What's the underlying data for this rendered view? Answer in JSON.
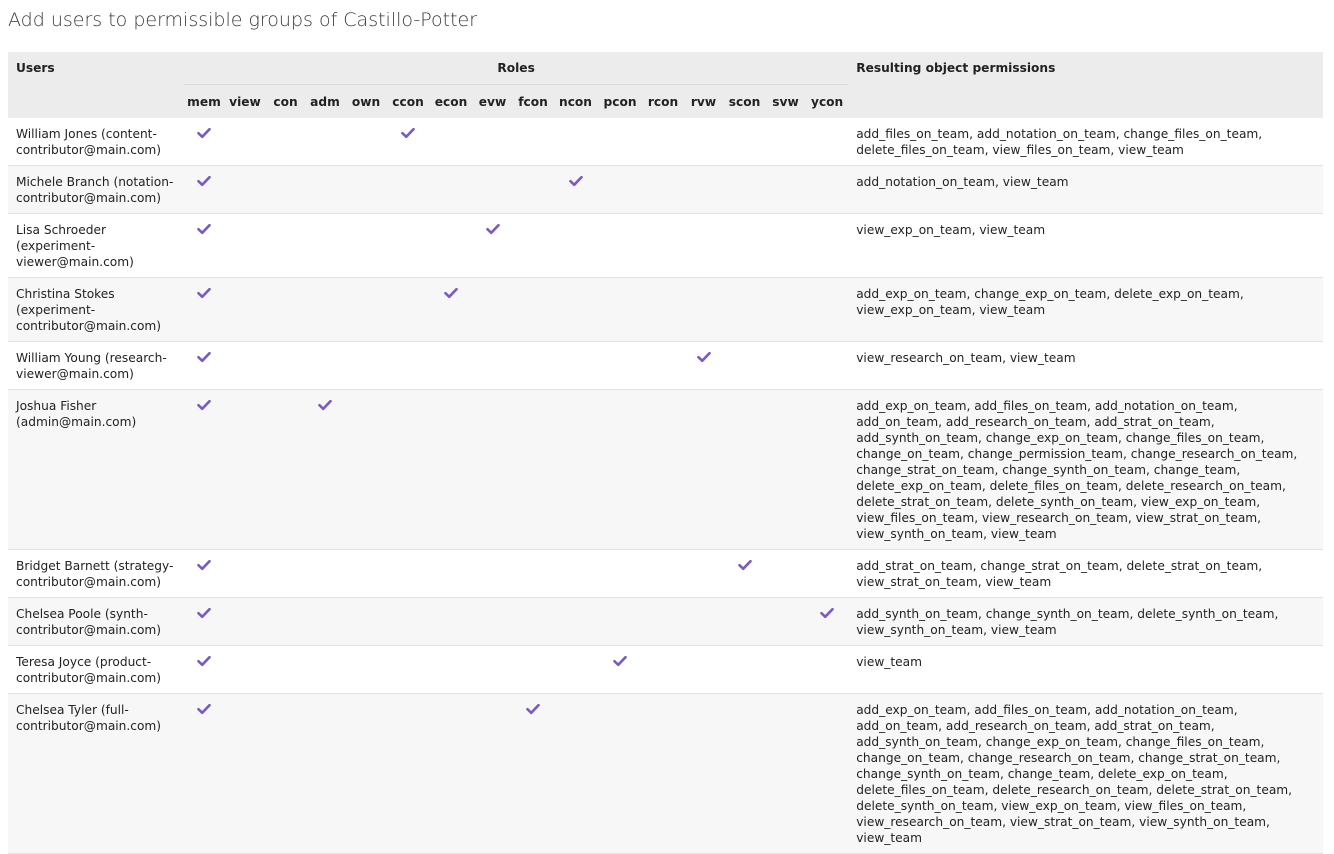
{
  "page": {
    "title": "Add users to permissible groups of Castillo-Potter"
  },
  "table": {
    "headers": {
      "users": "Users",
      "roles": "Roles",
      "permissions": "Resulting object permissions"
    },
    "roles": [
      "mem",
      "view",
      "con",
      "adm",
      "own",
      "ccon",
      "econ",
      "evw",
      "fcon",
      "ncon",
      "pcon",
      "rcon",
      "rvw",
      "scon",
      "svw",
      "ycon"
    ],
    "check_color": "#7a5bbf",
    "rows": [
      {
        "user": "William Jones (content-contributor@main.com)",
        "roles": [
          "mem",
          "ccon"
        ],
        "permissions": "add_files_on_team, add_notation_on_team, change_files_on_team, delete_files_on_team, view_files_on_team, view_team"
      },
      {
        "user": "Michele Branch (notation-contributor@main.com)",
        "roles": [
          "mem",
          "ncon"
        ],
        "permissions": "add_notation_on_team, view_team"
      },
      {
        "user": "Lisa Schroeder (experiment-viewer@main.com)",
        "roles": [
          "mem",
          "evw"
        ],
        "permissions": "view_exp_on_team, view_team"
      },
      {
        "user": "Christina Stokes (experiment-contributor@main.com)",
        "roles": [
          "mem",
          "econ"
        ],
        "permissions": "add_exp_on_team, change_exp_on_team, delete_exp_on_team, view_exp_on_team, view_team"
      },
      {
        "user": "William Young (research-viewer@main.com)",
        "roles": [
          "mem",
          "rvw"
        ],
        "permissions": "view_research_on_team, view_team"
      },
      {
        "user": "Joshua Fisher (admin@main.com)",
        "roles": [
          "mem",
          "adm"
        ],
        "permissions": "add_exp_on_team, add_files_on_team, add_notation_on_team, add_on_team, add_research_on_team, add_strat_on_team, add_synth_on_team, change_exp_on_team, change_files_on_team, change_on_team, change_permission_team, change_research_on_team, change_strat_on_team, change_synth_on_team, change_team, delete_exp_on_team, delete_files_on_team, delete_research_on_team, delete_strat_on_team, delete_synth_on_team, view_exp_on_team, view_files_on_team, view_research_on_team, view_strat_on_team, view_synth_on_team, view_team"
      },
      {
        "user": "Bridget Barnett (strategy-contributor@main.com)",
        "roles": [
          "mem",
          "scon"
        ],
        "permissions": "add_strat_on_team, change_strat_on_team, delete_strat_on_team, view_strat_on_team, view_team"
      },
      {
        "user": "Chelsea Poole (synth-contributor@main.com)",
        "roles": [
          "mem",
          "ycon"
        ],
        "permissions": "add_synth_on_team, change_synth_on_team, delete_synth_on_team, view_synth_on_team, view_team"
      },
      {
        "user": "Teresa Joyce (product-contributor@main.com)",
        "roles": [
          "mem",
          "pcon"
        ],
        "permissions": "view_team"
      },
      {
        "user": "Chelsea Tyler (full-contributor@main.com)",
        "roles": [
          "mem",
          "fcon"
        ],
        "permissions": "add_exp_on_team, add_files_on_team, add_notation_on_team, add_on_team, add_research_on_team, add_strat_on_team, add_synth_on_team, change_exp_on_team, change_files_on_team, change_on_team, change_research_on_team, change_strat_on_team, change_synth_on_team, change_team, delete_exp_on_team, delete_files_on_team, delete_research_on_team, delete_strat_on_team, delete_synth_on_team, view_exp_on_team, view_files_on_team, view_research_on_team, view_strat_on_team, view_synth_on_team, view_team"
      }
    ]
  }
}
